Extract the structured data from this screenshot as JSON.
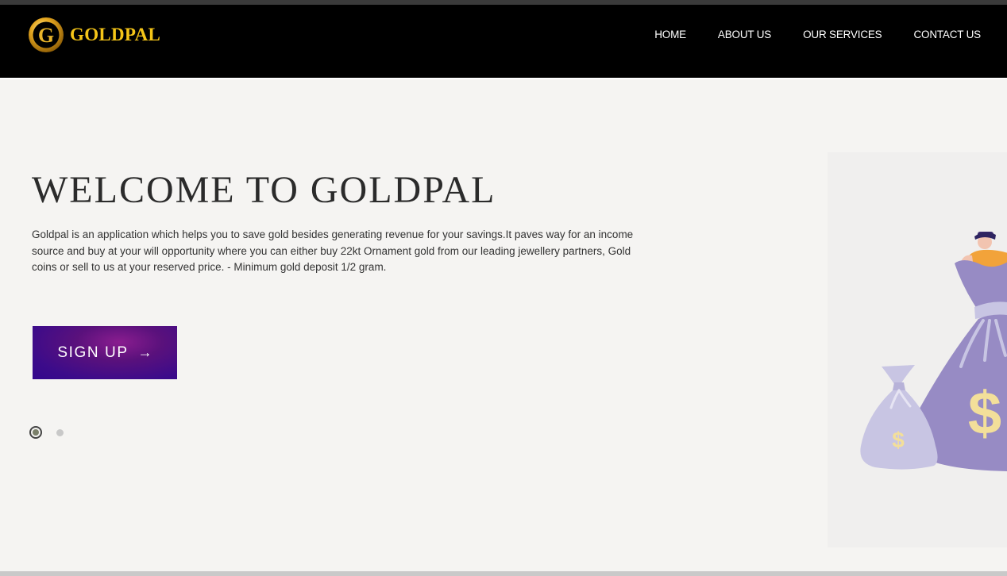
{
  "header": {
    "brand": "GOLDPAL",
    "logo_letter": "G",
    "nav": [
      {
        "label": "HOME"
      },
      {
        "label": "ABOUT US"
      },
      {
        "label": "OUR SERVICES"
      },
      {
        "label": "CONTACT US"
      }
    ]
  },
  "hero": {
    "title": "WELCOME TO GOLDPAL",
    "description": "Goldpal is an application which helps you to save gold besides generating revenue for your savings.It paves way for an income source and buy at your will opportunity where you can either buy 22kt Ornament gold from our leading jewellery partners, Gold coins or sell to us at your reserved price. - Minimum gold deposit 1/2 gram.",
    "signup_label": "SIGN UP",
    "signup_arrow": "→",
    "carousel": {
      "slides": 2,
      "active": 1
    },
    "illustration": {
      "bag_symbol": "$"
    }
  },
  "colors": {
    "brand_gold": "#f5c518",
    "nav_bg": "#000000",
    "button_purple": "#3c0b8a",
    "bag_purple": "#978bc4",
    "bag_light": "#c8c5e3",
    "dollar": "#f3df9a"
  }
}
